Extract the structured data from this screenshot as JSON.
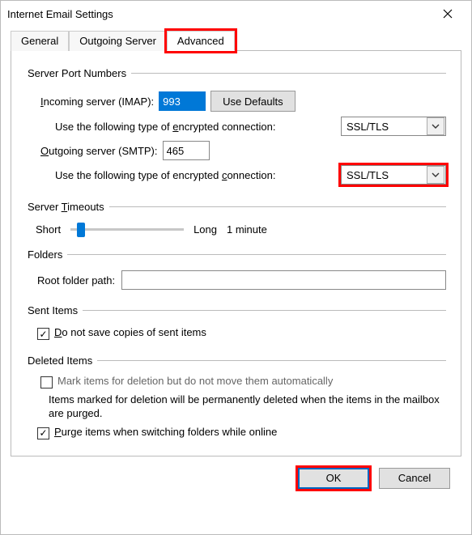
{
  "window": {
    "title": "Internet Email Settings"
  },
  "tabs": {
    "general": "General",
    "outgoing": "Outgoing Server",
    "advanced": "Advanced"
  },
  "server_ports": {
    "legend": "Server Port Numbers",
    "incoming_label_pre": "I",
    "incoming_label": "ncoming server (IMAP):",
    "incoming_value": "993",
    "use_defaults": "Use Defaults",
    "enc_label_pre": "Use the following type of ",
    "enc_label_u": "e",
    "enc_label_post": "ncrypted connection:",
    "enc_in_value": "SSL/TLS",
    "outgoing_label_pre": "O",
    "outgoing_label": "utgoing server (SMTP):",
    "outgoing_value": "465",
    "enc_out_label_pre": "Use the following type of encrypted ",
    "enc_out_label_u": "c",
    "enc_out_label_post": "onnection:",
    "enc_out_value": "SSL/TLS"
  },
  "timeouts": {
    "legend": "Server Timeouts",
    "short": "Short",
    "long": "Long",
    "value": "1 minute"
  },
  "folders": {
    "legend": "Folders",
    "root_label": "Root folder path:",
    "root_value": ""
  },
  "sent": {
    "legend": "Sent Items",
    "do_not_save_pre": "D",
    "do_not_save": "o not save copies of sent items"
  },
  "deleted": {
    "legend": "Deleted Items",
    "mark_label": "Mark items for deletion but do not move them automatically",
    "note": "Items marked for deletion will be permanently deleted when the items in the mailbox are purged.",
    "purge_pre": "P",
    "purge": "urge items when switching folders while online"
  },
  "buttons": {
    "ok": "OK",
    "cancel": "Cancel"
  }
}
